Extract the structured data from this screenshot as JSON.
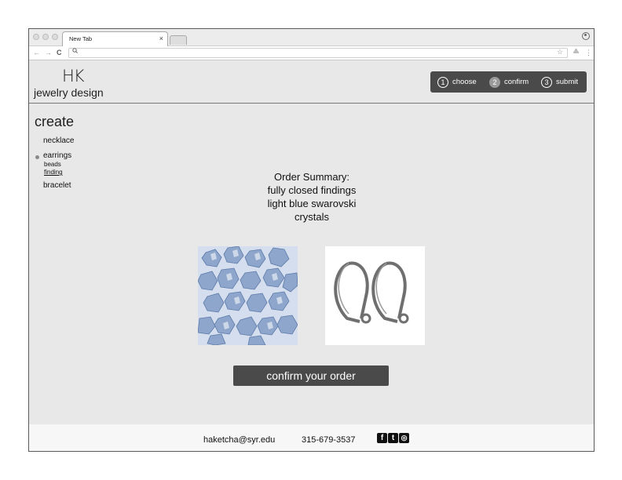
{
  "browser": {
    "tab_title": "New Tab",
    "tab_close": "×",
    "nav_back": "←",
    "nav_forward": "→",
    "nav_reload": "C",
    "search_glyph": "🔍︎",
    "bookmark_star": "☆",
    "menu_dots": "⋮"
  },
  "header": {
    "logo_mark": "HK",
    "logo_text": "jewelry design",
    "steps": [
      {
        "num": "1",
        "label": "choose",
        "active": false
      },
      {
        "num": "2",
        "label": "confirm",
        "active": true
      },
      {
        "num": "3",
        "label": "submit",
        "active": false
      }
    ]
  },
  "sidebar": {
    "title": "create",
    "items": [
      {
        "label": "necklace"
      },
      {
        "label": "earrings"
      },
      {
        "label": "bracelet"
      }
    ],
    "sub_items": [
      {
        "label": "beads"
      },
      {
        "label": "finding"
      }
    ]
  },
  "summary": {
    "lines": [
      "Order Summary:",
      "fully closed findings",
      "light blue swarovski",
      "crystals"
    ]
  },
  "images": {
    "crystals": "light blue swarovski crystals",
    "findings": "fully closed earring findings"
  },
  "confirm_button": "confirm your order",
  "footer": {
    "email": "haketcha@syr.edu",
    "phone": "315-679-3537",
    "social": [
      {
        "icon": "facebook-icon",
        "glyph": "f"
      },
      {
        "icon": "twitter-icon",
        "glyph": "t"
      },
      {
        "icon": "instagram-icon",
        "glyph": "◎"
      }
    ]
  },
  "colors": {
    "page_bg": "#e8e8e8",
    "dark_button": "#4a4a4a",
    "footer_bg": "#f7f7f7",
    "crystal_blue": "#9fb4d6"
  }
}
